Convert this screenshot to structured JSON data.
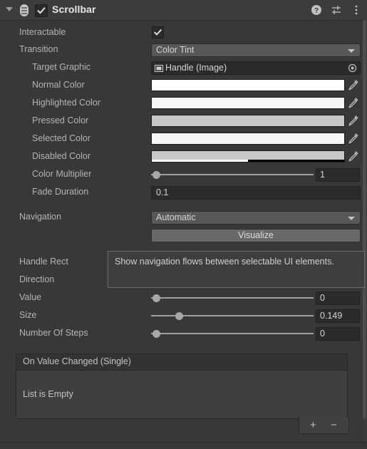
{
  "header": {
    "title": "Scrollbar",
    "enabled_checkbox": true,
    "foldout_expanded": true,
    "icons": [
      {
        "name": "help-icon",
        "glyph": "?"
      },
      {
        "name": "preset-icon",
        "glyph": "preset"
      },
      {
        "name": "more-menu-icon",
        "glyph": "kebab"
      }
    ]
  },
  "rows": {
    "interactable": {
      "label": "Interactable",
      "checked": true
    },
    "transition": {
      "label": "Transition",
      "value": "Color Tint"
    },
    "target_graphic": {
      "label": "Target Graphic",
      "value": "Handle (Image)"
    },
    "normal_color": {
      "label": "Normal Color",
      "color": "#FFFFFF",
      "alpha": 1.0
    },
    "highlighted_color": {
      "label": "Highlighted Color",
      "color": "#F5F5F5",
      "alpha": 1.0
    },
    "pressed_color": {
      "label": "Pressed Color",
      "color": "#C8C8C8",
      "alpha": 1.0
    },
    "selected_color": {
      "label": "Selected Color",
      "color": "#F5F5F5",
      "alpha": 1.0
    },
    "disabled_color": {
      "label": "Disabled Color",
      "color": "#C8C8C8",
      "alpha": 0.5
    },
    "color_multiplier": {
      "label": "Color Multiplier",
      "value": "1",
      "slider_pct": 0
    },
    "fade_duration": {
      "label": "Fade Duration",
      "value": "0.1"
    },
    "navigation": {
      "label": "Navigation",
      "value": "Automatic"
    },
    "visualize": {
      "label": "Visualize"
    },
    "handle_rect": {
      "label": "Handle Rect"
    },
    "direction": {
      "label": "Direction"
    },
    "value": {
      "label": "Value",
      "value": "0",
      "slider_pct": 0
    },
    "size": {
      "label": "Size",
      "value": "0.149",
      "slider_pct": 15
    },
    "number_of_steps": {
      "label": "Number Of Steps",
      "value": "0",
      "slider_pct": 0
    }
  },
  "tooltip": {
    "text": "Show navigation flows between selectable UI elements."
  },
  "event_section": {
    "header": "On Value Changed (Single)",
    "empty_text": "List is Empty",
    "add_label": "+",
    "remove_label": "−"
  },
  "colors": {
    "panel_bg": "#383838",
    "header_bg": "#3C3C3C",
    "label": "#B4B4B4",
    "field_bg": "#2B2B2B",
    "dropdown_bg": "#585858",
    "button_bg": "#696969",
    "tooltip_bg": "#3E3E3E"
  }
}
